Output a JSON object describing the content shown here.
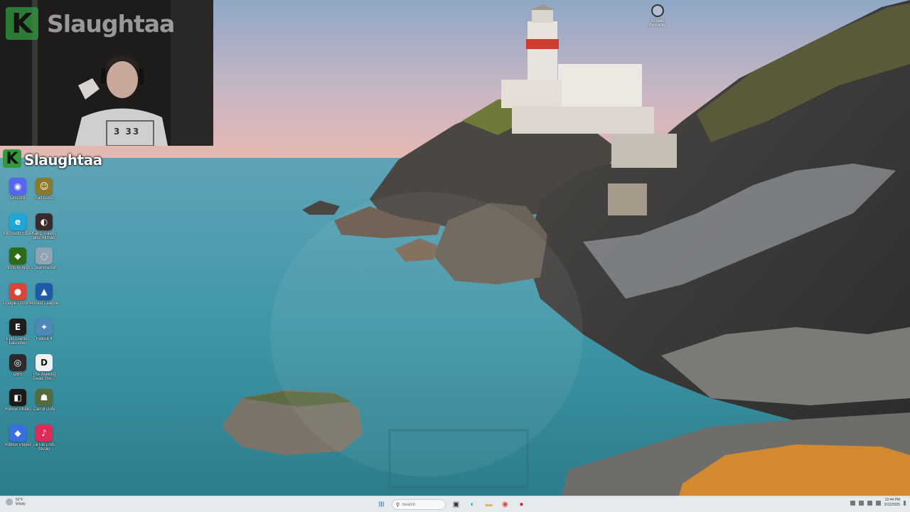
{
  "streamer": {
    "name": "Slaughtaa",
    "logo_letter": "K",
    "brand_color": "#2f9b3e"
  },
  "webcam": {
    "shirt_text": "3 33"
  },
  "desktop_icons": [
    {
      "label": "Discord",
      "icon": "discord-icon",
      "color": "#5865f2",
      "glyph": "◉"
    },
    {
      "label": "Fall Guys",
      "icon": "fall-guys-icon",
      "color": "#8a7a2a",
      "glyph": "☺"
    },
    {
      "label": "Microsoft Edge",
      "icon": "edge-icon",
      "color": "#1fa5d8",
      "glyph": "e"
    },
    {
      "label": "Kang Tokens and Hitman",
      "icon": "game-icon",
      "color": "#3a2a2a",
      "glyph": "◐"
    },
    {
      "label": "NVIDIA App",
      "icon": "nvidia-icon",
      "color": "#2d6b14",
      "glyph": "◆"
    },
    {
      "label": "Cleanmaster",
      "icon": "cleaner-icon",
      "color": "#8fa3b3",
      "glyph": "◌"
    },
    {
      "label": "Google Chrome",
      "icon": "chrome-icon",
      "color": "#db4437",
      "glyph": "●"
    },
    {
      "label": "Rocket League",
      "icon": "rocket-league-icon",
      "color": "#1f5aa8",
      "glyph": "▲"
    },
    {
      "label": "Epic Games Launcher",
      "icon": "epic-games-icon",
      "color": "#1e1e1e",
      "glyph": "E"
    },
    {
      "label": "Fallout 4",
      "icon": "fallout-icon",
      "color": "#4e88b9",
      "glyph": "✦"
    },
    {
      "label": "OBS",
      "icon": "obs-icon",
      "color": "#2b2b2b",
      "glyph": "◎"
    },
    {
      "label": "The Walking Dead The...",
      "icon": "walking-dead-icon",
      "color": "#f0f0f0",
      "glyph": "D"
    },
    {
      "label": "Roblox Studio",
      "icon": "roblox-studio-icon",
      "color": "#1a1a1a",
      "glyph": "◧"
    },
    {
      "label": "Call of Duty",
      "icon": "game-icon-2",
      "color": "#556b3c",
      "glyph": "☗"
    },
    {
      "label": "Roblox Player",
      "icon": "roblox-player-icon",
      "color": "#3a6fe0",
      "glyph": "◆"
    },
    {
      "label": "TikTok LIVE Studio",
      "icon": "tiktok-icon",
      "color": "#e02a5a",
      "glyph": "♪"
    }
  ],
  "corner_shortcut": {
    "label": "Screen Recorder",
    "icon": "recorder-icon"
  },
  "taskbar": {
    "weather": {
      "temp": "52°F",
      "condition": "Windy"
    },
    "search_placeholder": "Search",
    "pinned": [
      {
        "name": "start-button",
        "icon": "windows-icon",
        "color": "#2a7ad8",
        "glyph": "⊞"
      },
      {
        "name": "task-view-button",
        "icon": "task-view-icon",
        "color": "#333",
        "glyph": "▣"
      },
      {
        "name": "edge-taskbar-button",
        "icon": "edge-icon",
        "color": "#1fa5d8",
        "glyph": "◐"
      },
      {
        "name": "file-explorer-button",
        "icon": "folder-icon",
        "color": "#e5b84a",
        "glyph": "▬"
      },
      {
        "name": "chrome-taskbar-button",
        "icon": "chrome-icon",
        "color": "#db4437",
        "glyph": "◉"
      },
      {
        "name": "app-taskbar-button",
        "icon": "app-icon",
        "color": "#cc2233",
        "glyph": "●"
      }
    ],
    "clock_time": "12:44 PM",
    "clock_date": "2/12/2025"
  }
}
